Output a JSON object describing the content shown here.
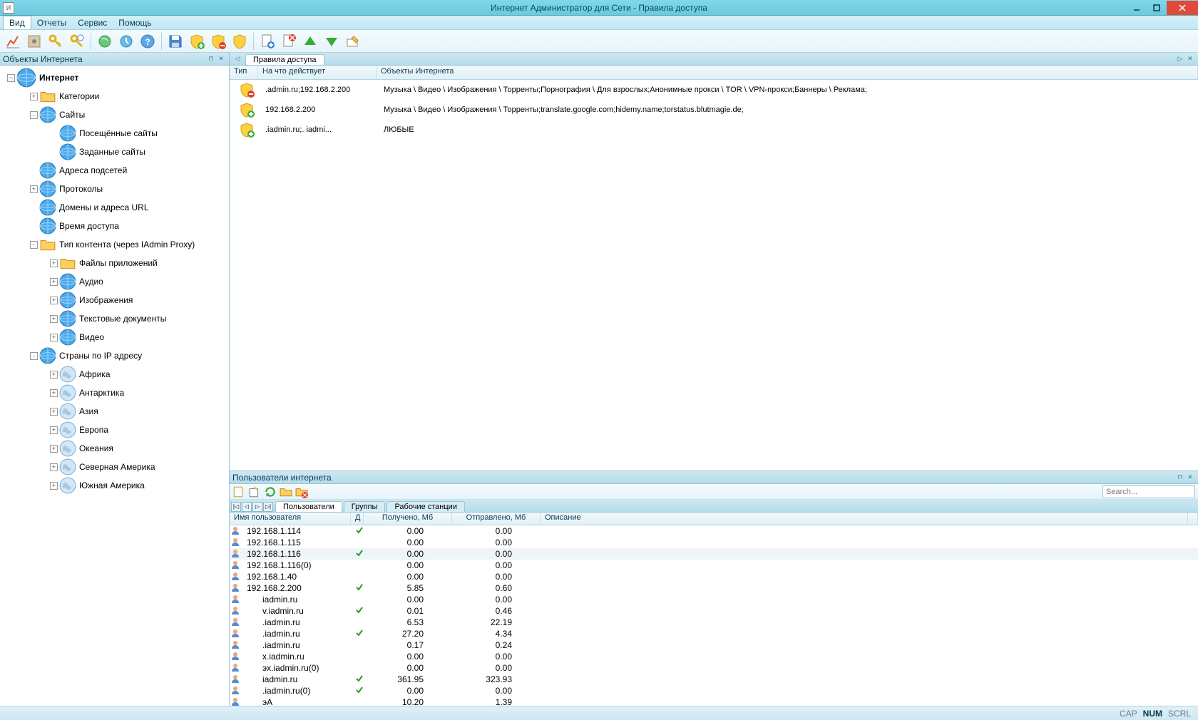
{
  "title": "Интернет Администратор для Сети - Правила доступа",
  "app_icon_letter": "И",
  "menu": {
    "items": [
      "Вид",
      "Отчеты",
      "Сервис",
      "Помощь"
    ],
    "active": 0
  },
  "left_panel": {
    "title": "Объекты Интернета",
    "root": "Интернет",
    "nodes": [
      {
        "indent": 1,
        "exp": "+",
        "icon": "folder",
        "label": "Категории"
      },
      {
        "indent": 1,
        "exp": "-",
        "icon": "sites",
        "label": "Сайты"
      },
      {
        "indent": 2,
        "exp": "",
        "icon": "visited",
        "label": "Посещённые сайты"
      },
      {
        "indent": 2,
        "exp": "",
        "icon": "defined",
        "label": "Заданные сайты"
      },
      {
        "indent": 1,
        "exp": "",
        "icon": "subnet",
        "label": "Адреса подсетей"
      },
      {
        "indent": 1,
        "exp": "+",
        "icon": "proto",
        "label": "Протоколы"
      },
      {
        "indent": 1,
        "exp": "",
        "icon": "domains",
        "label": "Домены и адреса URL"
      },
      {
        "indent": 1,
        "exp": "",
        "icon": "clock",
        "label": "Время доступа"
      },
      {
        "indent": 1,
        "exp": "-",
        "icon": "content",
        "label": "Тип контента (через IAdmin Proxy)"
      },
      {
        "indent": 2,
        "exp": "+",
        "icon": "appfiles",
        "label": "Файлы приложений"
      },
      {
        "indent": 2,
        "exp": "+",
        "icon": "audio",
        "label": "Аудио"
      },
      {
        "indent": 2,
        "exp": "+",
        "icon": "images",
        "label": "Изображения"
      },
      {
        "indent": 2,
        "exp": "+",
        "icon": "textdoc",
        "label": "Текстовые документы"
      },
      {
        "indent": 2,
        "exp": "+",
        "icon": "video",
        "label": "Видео"
      },
      {
        "indent": 1,
        "exp": "-",
        "icon": "globe",
        "label": "Страны по IP адресу"
      },
      {
        "indent": 2,
        "exp": "+",
        "icon": "continent",
        "label": "Африка"
      },
      {
        "indent": 2,
        "exp": "+",
        "icon": "continent",
        "label": "Антарктика"
      },
      {
        "indent": 2,
        "exp": "+",
        "icon": "continent",
        "label": "Азия"
      },
      {
        "indent": 2,
        "exp": "+",
        "icon": "continent",
        "label": "Европа"
      },
      {
        "indent": 2,
        "exp": "+",
        "icon": "continent",
        "label": "Океания"
      },
      {
        "indent": 2,
        "exp": "+",
        "icon": "continent",
        "label": "Северная Америка"
      },
      {
        "indent": 2,
        "exp": "+",
        "icon": "continent",
        "label": "Южная Америка"
      }
    ]
  },
  "rules_panel": {
    "tab": "Правила доступа",
    "columns": [
      "Тип",
      "На что действует",
      "Объекты Интернета"
    ],
    "rows": [
      {
        "type": "deny",
        "target": ".admin.ru;192.168.2.200",
        "objects": "Музыка \\ Видео \\ Изображения \\ Торренты;Порнография \\ Для взрослых;Анонимные прокси \\ TOR \\ VPN-прокси;Баннеры \\ Реклама;"
      },
      {
        "type": "allow",
        "target": "192.168.2.200",
        "objects": "Музыка \\ Видео \\ Изображения \\ Торренты;translate.google.com;hidemy.name;torstatus.blutmagie.de;"
      },
      {
        "type": "allow",
        "target": ".iadmin.ru;.           iadmi...",
        "objects": "ЛЮБЫЕ"
      }
    ]
  },
  "users_panel": {
    "title": "Пользователи интернета",
    "search_placeholder": "Search...",
    "tabs": [
      "Пользователи",
      "Группы",
      "Рабочие станции"
    ],
    "active_tab": 0,
    "columns": [
      "Имя пользователя",
      "Д",
      "Получено, Мб",
      "Отправлено, Мб",
      "Описание"
    ],
    "rows": [
      {
        "name": "192.168.1.114",
        "d": true,
        "rcv": "0.00",
        "snt": "0.00",
        "indent": 0
      },
      {
        "name": "192.168.1.115",
        "d": false,
        "rcv": "0.00",
        "snt": "0.00",
        "indent": 0
      },
      {
        "name": "192.168.1.116",
        "d": true,
        "rcv": "0.00",
        "snt": "0.00",
        "indent": 0
      },
      {
        "name": "192.168.1.116(0)",
        "d": false,
        "rcv": "0.00",
        "snt": "0.00",
        "indent": 0
      },
      {
        "name": "192.168.1.40",
        "d": false,
        "rcv": "0.00",
        "snt": "0.00",
        "indent": 0
      },
      {
        "name": "192.168.2.200",
        "d": true,
        "rcv": "5.85",
        "snt": "0.60",
        "indent": 0
      },
      {
        "name": "iadmin.ru",
        "d": false,
        "rcv": "0.00",
        "snt": "0.00",
        "indent": 1
      },
      {
        "name": "v.iadmin.ru",
        "d": true,
        "rcv": "0.01",
        "snt": "0.46",
        "indent": 1
      },
      {
        "name": ".iadmin.ru",
        "d": false,
        "rcv": "6.53",
        "snt": "22.19",
        "indent": 1
      },
      {
        "name": ".iadmin.ru",
        "d": true,
        "rcv": "27.20",
        "snt": "4.34",
        "indent": 1
      },
      {
        "name": ".iadmin.ru",
        "d": false,
        "rcv": "0.17",
        "snt": "0.24",
        "indent": 1
      },
      {
        "name": "x.iadmin.ru",
        "d": false,
        "rcv": "0.00",
        "snt": "0.00",
        "indent": 1
      },
      {
        "name": "эx.iadmin.ru(0)",
        "d": false,
        "rcv": "0.00",
        "snt": "0.00",
        "indent": 1
      },
      {
        "name": "iadmin.ru",
        "d": true,
        "rcv": "361.95",
        "snt": "323.93",
        "indent": 1
      },
      {
        "name": ".iadmin.ru(0)",
        "d": true,
        "rcv": "0.00",
        "snt": "0.00",
        "indent": 1
      },
      {
        "name": "эA",
        "d": false,
        "rcv": "10.20",
        "snt": "1.39",
        "indent": 1
      }
    ]
  },
  "status": {
    "cap": "CAP",
    "num": "NUM",
    "scrl": "SCRL"
  }
}
